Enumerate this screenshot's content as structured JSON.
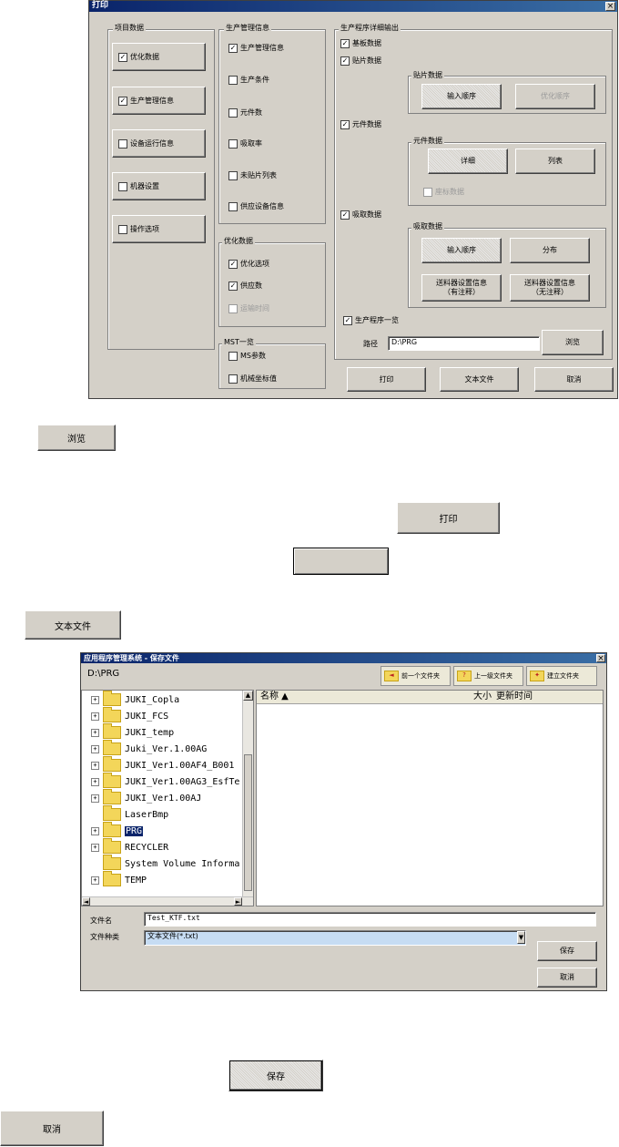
{
  "print_dialog": {
    "title": "打印",
    "close": "×",
    "project_group": {
      "label": "项目数据",
      "items": [
        {
          "label": "优化数据",
          "checked": true
        },
        {
          "label": "生产管理信息",
          "checked": true
        },
        {
          "label": "设备运行信息",
          "checked": false
        },
        {
          "label": "机器设置",
          "checked": false
        },
        {
          "label": "操作选项",
          "checked": false
        }
      ]
    },
    "production_group": {
      "label": "生产管理信息",
      "items": [
        {
          "label": "生产管理信息",
          "checked": true
        },
        {
          "label": "生产条件",
          "checked": false
        },
        {
          "label": "元件数",
          "checked": false
        },
        {
          "label": "吸取率",
          "checked": false
        },
        {
          "label": "未贴片列表",
          "checked": false
        },
        {
          "label": "供应设备信息",
          "checked": false
        }
      ]
    },
    "optimize_group": {
      "label": "优化数据",
      "items": [
        {
          "label": "优化选项",
          "checked": true,
          "disabled": false
        },
        {
          "label": "供应数",
          "checked": true,
          "disabled": false
        },
        {
          "label": "运输时间",
          "checked": false,
          "disabled": true
        }
      ]
    },
    "mst_group": {
      "label": "MST一览",
      "items": [
        {
          "label": "MS参数",
          "checked": false
        },
        {
          "label": "机械坐标值",
          "checked": false
        }
      ]
    },
    "detail_group": {
      "label": "生产程序详细输出",
      "substrate": {
        "label": "基板数据",
        "checked": true
      },
      "placement": {
        "label": "贴片数据",
        "checked": true
      },
      "placement_sub": {
        "label": "贴片数据",
        "btn_input_order": "输入顺序",
        "btn_opt_order": "优化顺序"
      },
      "component": {
        "label": "元件数据",
        "checked": true
      },
      "component_sub": {
        "label": "元件数据",
        "btn_detail": "详细",
        "btn_list": "列表",
        "pos_label": "座标数据"
      },
      "pickup": {
        "label": "吸取数据",
        "checked": true
      },
      "pickup_sub": {
        "label": "吸取数据",
        "btn_input_order": "输入顺序",
        "btn_distribution": "分布",
        "btn_feeder_info_comment": "送料器设置信息\n（有注释）",
        "btn_feeder_info_nocomment": "送料器设置信息\n（无注释）"
      },
      "program_list": {
        "label": "生产程序一览",
        "checked": true
      },
      "path_label": "路径",
      "path_value": "D:\\PRG",
      "browse": "浏览"
    },
    "footer": {
      "print": "打印",
      "text_file": "文本文件",
      "cancel": "取消"
    }
  },
  "standalone": {
    "browse": "浏览",
    "print": "打印",
    "text_file": "文本文件",
    "save": "保存",
    "cancel": "取消"
  },
  "save_dialog": {
    "title": "应用程序管理系统 - 保存文件",
    "close": "×",
    "path": "D:\\PRG",
    "toolbar": {
      "prev": "前一个文件夹",
      "up": "上一级文件夹",
      "new_folder": "建立文件夹"
    },
    "tree": [
      {
        "label": "JUKI_Copla",
        "plus": true,
        "selected": false
      },
      {
        "label": "JUKI_FCS",
        "plus": true,
        "selected": false
      },
      {
        "label": "JUKI_temp",
        "plus": true,
        "selected": false
      },
      {
        "label": "Juki_Ver.1.00AG",
        "plus": true,
        "selected": false
      },
      {
        "label": "JUKI_Ver1.00AF4_B001",
        "plus": true,
        "selected": false
      },
      {
        "label": "JUKI_Ver1.00AG3_EsfTe",
        "plus": true,
        "selected": false
      },
      {
        "label": "JUKI_Ver1.00AJ",
        "plus": true,
        "selected": false
      },
      {
        "label": "LaserBmp",
        "plus": false,
        "selected": false
      },
      {
        "label": "PRG",
        "plus": true,
        "selected": true
      },
      {
        "label": "RECYCLER",
        "plus": true,
        "selected": false
      },
      {
        "label": "System Volume Informa",
        "plus": false,
        "selected": false
      },
      {
        "label": "TEMP",
        "plus": true,
        "selected": false
      }
    ],
    "columns": {
      "name": "名称 ▲",
      "size": "大小",
      "updated": "更新时间"
    },
    "filename_label": "文件名",
    "filename_value": "Test_KTF.txt",
    "filetype_label": "文件种类",
    "filetype_value": "文本文件(*.txt)",
    "save": "保存",
    "cancel": "取消"
  },
  "colors": {
    "dialog_bg": "#d4d0c8",
    "title_bar": "#0a246a",
    "selection": "#0a246a",
    "folder": "#f3d65a"
  }
}
